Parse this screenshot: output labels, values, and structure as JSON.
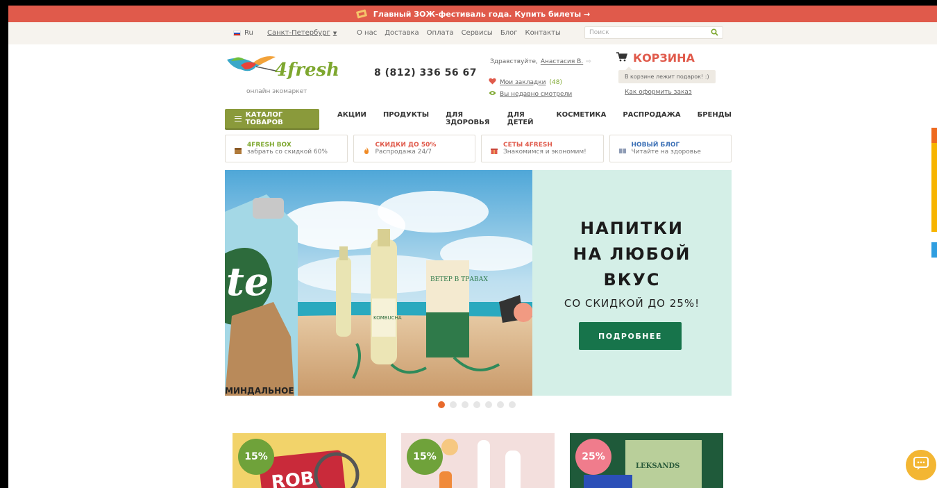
{
  "promo": {
    "text": "Главный ЗОЖ-фестиваль года. Купить билеты →"
  },
  "topbar": {
    "lang": "Ru",
    "city": "Санкт-Петербург",
    "links": [
      "О нас",
      "Доставка",
      "Оплата",
      "Сервисы",
      "Блог",
      "Контакты"
    ],
    "search_placeholder": "Поиск"
  },
  "header": {
    "logo_text": "4fresh",
    "logo_sub": "онлайн экомаркет",
    "phone": "8 (812) 336 56 67",
    "hello_prefix": "Здравствуйте,",
    "user_name": "Анастасия В.",
    "bookmarks_label": "Мои закладки",
    "bookmarks_count": "(48)",
    "recent_label": "Вы недавно смотрели",
    "cart_title": "КОРЗИНА",
    "cart_note": "В корзине лежит подарок! :)",
    "howto": "Как оформить заказ"
  },
  "nav": {
    "catalog": "КАТАЛОГ ТОВАРОВ",
    "items": [
      "АКЦИИ",
      "ПРОДУКТЫ",
      "ДЛЯ ЗДОРОВЬЯ",
      "ДЛЯ ДЕТЕЙ",
      "КОСМЕТИКА",
      "РАСПРОДАЖА",
      "БРЕНДЫ"
    ]
  },
  "cards": [
    {
      "title": "4FRESH BOX",
      "sub": "забрать со скидкой 60%",
      "color": "#7ea72f"
    },
    {
      "title": "СКИДКИ ДО 50%",
      "sub": "Распродажа 24/7",
      "color": "#e05a4b"
    },
    {
      "title": "СЕТЫ 4FRESH",
      "sub": "Знакомимся и экономим!",
      "color": "#e05a4b"
    },
    {
      "title": "НОВЫЙ БЛОГ",
      "sub": "Читайте на здоровье",
      "color": "#3a6fb5"
    }
  ],
  "hero": {
    "title_lines": [
      "НАПИТКИ",
      "НА ЛЮБОЙ",
      "ВКУС"
    ],
    "subtitle": "СО СКИДКОЙ ДО 25%!",
    "button": "ПОДРОБНЕЕ",
    "carton_text": "МИНДАЛЬНОЕ",
    "bottle_label": "KOMBUCHA",
    "box_label": "ВЕТЕР В ТРАВАХ",
    "slide_count": 7,
    "active_slide": 1
  },
  "tiles": [
    {
      "badge": "15%",
      "badge_color": "#6fa23a"
    },
    {
      "badge": "15%",
      "badge_color": "#6fa23a"
    },
    {
      "badge": "25%",
      "badge_color": "#f07c8c"
    }
  ],
  "colors": {
    "accent_red": "#e05a4b",
    "brand_green": "#7ea72f",
    "hero_bg": "#d4efe7",
    "hero_button": "#17744b",
    "catalog_button": "#8a9a3b"
  }
}
